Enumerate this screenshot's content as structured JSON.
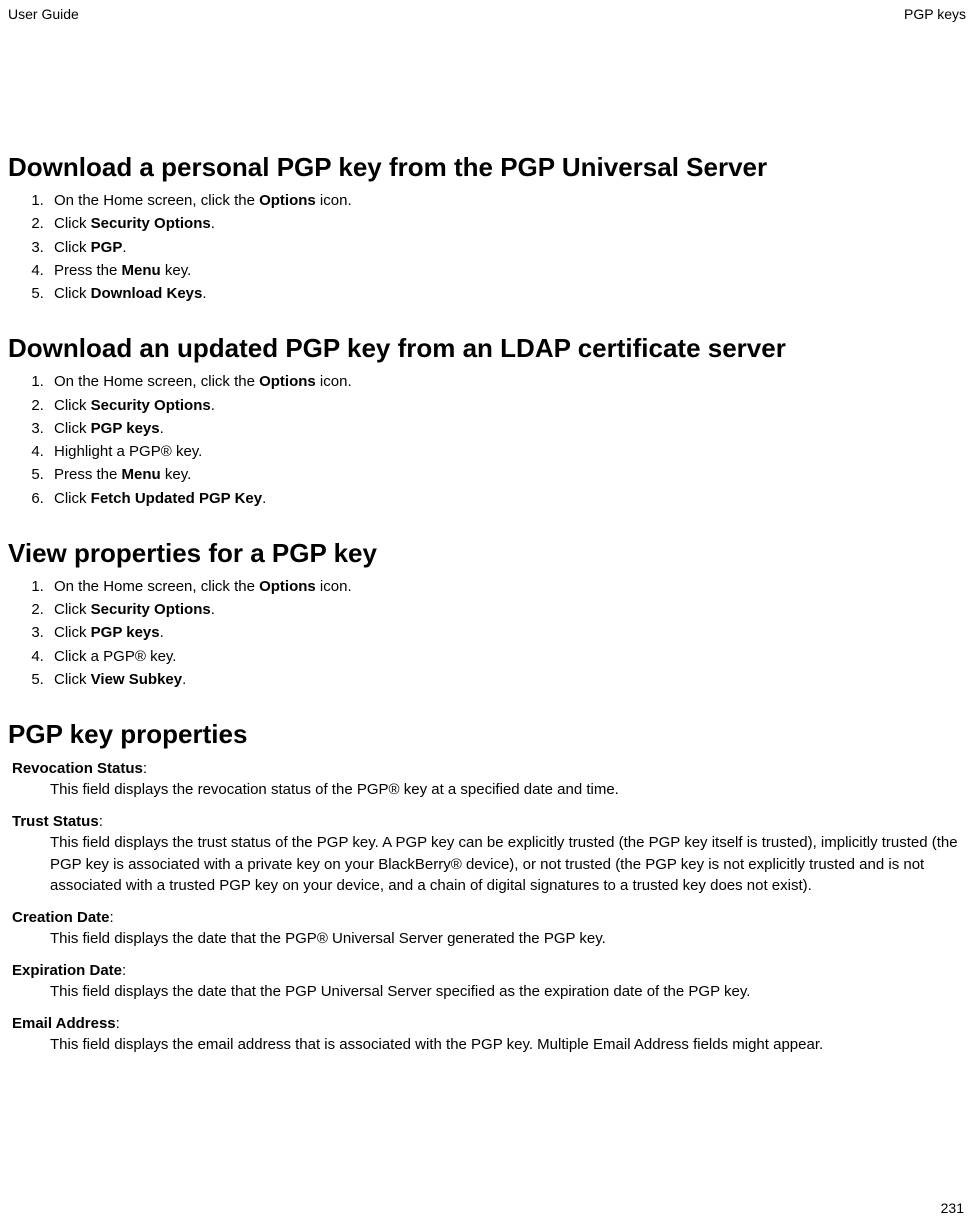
{
  "header": {
    "left": "User Guide",
    "right": "PGP keys"
  },
  "pageNumber": "231",
  "sections": {
    "s1": {
      "title": "Download a personal PGP key from the PGP Universal Server",
      "steps": [
        {
          "pre": "On the Home screen, click the ",
          "bold": "Options",
          "post": " icon."
        },
        {
          "pre": "Click ",
          "bold": "Security Options",
          "post": "."
        },
        {
          "pre": "Click ",
          "bold": "PGP",
          "post": "."
        },
        {
          "pre": "Press the ",
          "bold": "Menu",
          "post": " key."
        },
        {
          "pre": "Click ",
          "bold": "Download Keys",
          "post": "."
        }
      ]
    },
    "s2": {
      "title": "Download an updated PGP key from an LDAP certificate server",
      "steps": [
        {
          "pre": "On the Home screen, click the ",
          "bold": "Options",
          "post": " icon."
        },
        {
          "pre": "Click ",
          "bold": "Security Options",
          "post": "."
        },
        {
          "pre": "Click ",
          "bold": "PGP keys",
          "post": "."
        },
        {
          "pre": "Highlight a PGP® key.",
          "bold": "",
          "post": ""
        },
        {
          "pre": "Press the ",
          "bold": "Menu",
          "post": " key."
        },
        {
          "pre": "Click ",
          "bold": "Fetch Updated PGP Key",
          "post": "."
        }
      ]
    },
    "s3": {
      "title": "View properties for a PGP key",
      "steps": [
        {
          "pre": "On the Home screen, click the ",
          "bold": "Options",
          "post": " icon."
        },
        {
          "pre": "Click ",
          "bold": "Security Options",
          "post": "."
        },
        {
          "pre": "Click ",
          "bold": "PGP keys",
          "post": "."
        },
        {
          "pre": "Click a PGP® key.",
          "bold": "",
          "post": ""
        },
        {
          "pre": "Click ",
          "bold": "View Subkey",
          "post": "."
        }
      ]
    },
    "s4": {
      "title": "PGP key properties",
      "defs": [
        {
          "term": "Revocation Status",
          "desc": "This field displays the revocation status of the PGP® key at a specified date and time."
        },
        {
          "term": "Trust Status",
          "desc": "This field displays the trust status of the PGP key. A PGP key can be explicitly trusted (the PGP key itself is trusted), implicitly trusted (the PGP key is associated with a private key on your BlackBerry® device), or not trusted (the PGP key is not explicitly trusted and is not associated with a trusted PGP key on your device, and a chain of digital signatures to a trusted key does not exist)."
        },
        {
          "term": "Creation Date",
          "desc": "This field displays the date that the PGP® Universal Server generated the PGP key."
        },
        {
          "term": "Expiration Date",
          "desc": "This field displays the date that the PGP Universal Server specified as the expiration date of the PGP key."
        },
        {
          "term": "Email Address",
          "desc": "This field displays the email address that is associated with the PGP key. Multiple Email Address fields might appear."
        }
      ]
    }
  }
}
